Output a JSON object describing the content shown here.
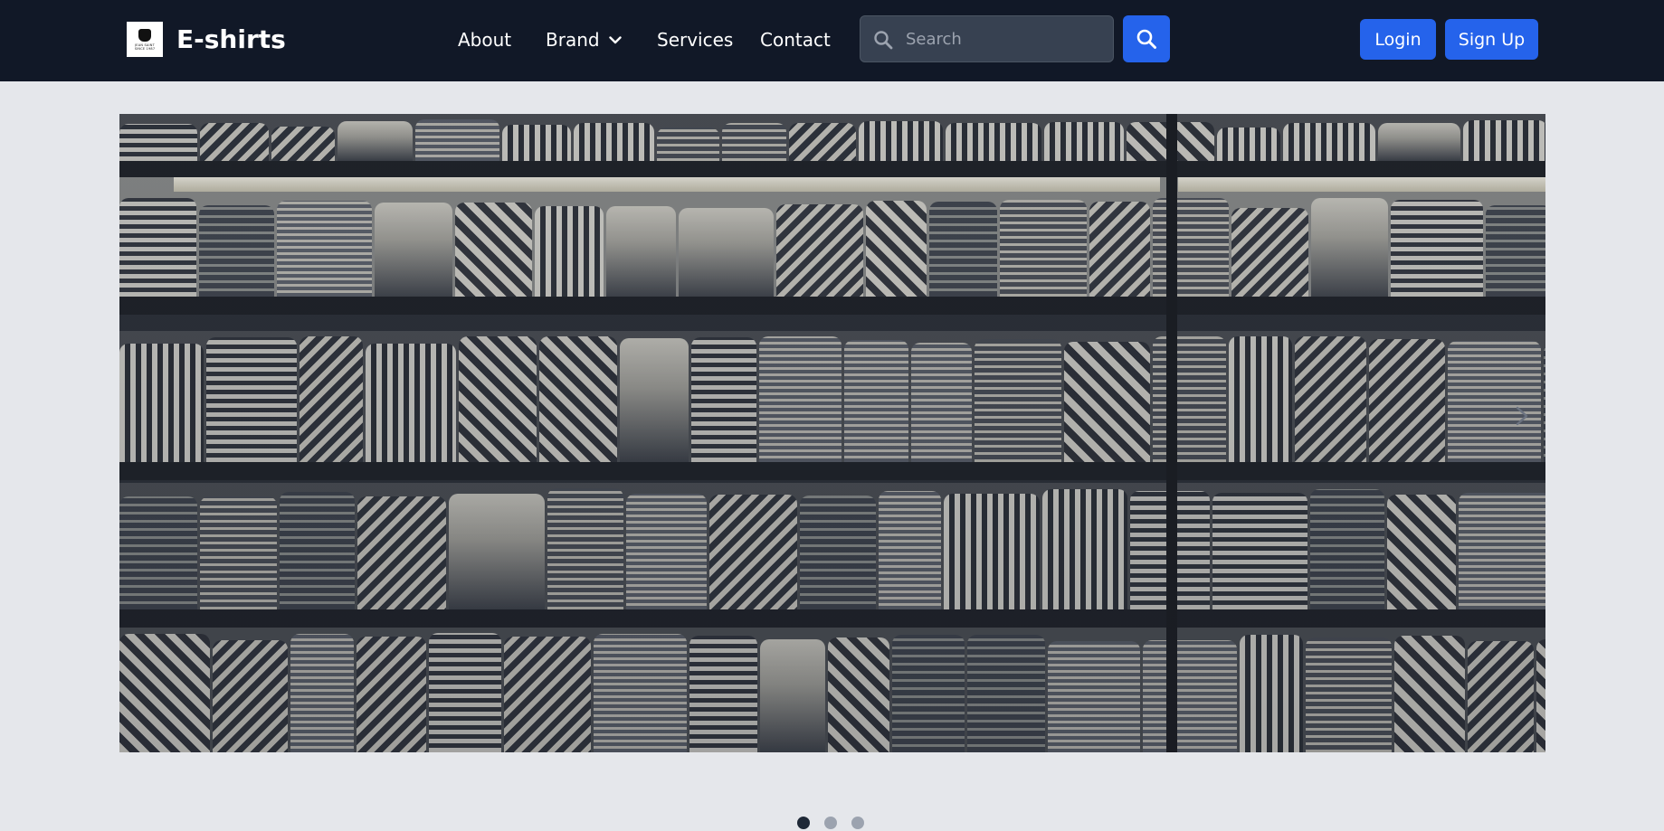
{
  "header": {
    "brand": "E-shirts",
    "logo_text": [
      "JEAN SAINT",
      "SINCE 1987"
    ],
    "nav": {
      "about": "About",
      "brand": "Brand",
      "services": "Services",
      "contact": "Contact"
    },
    "search": {
      "placeholder": "Search",
      "value": ""
    },
    "login": "Login",
    "signup": "Sign Up"
  },
  "carousel": {
    "image": "Shelves stocked with folded patterned t-shirts",
    "slides": 3,
    "active_slide": 1
  },
  "colors": {
    "navbar_bg": "#111827",
    "page_bg": "#e5e7eb",
    "accent": "#2563eb",
    "search_bg": "#374151"
  }
}
